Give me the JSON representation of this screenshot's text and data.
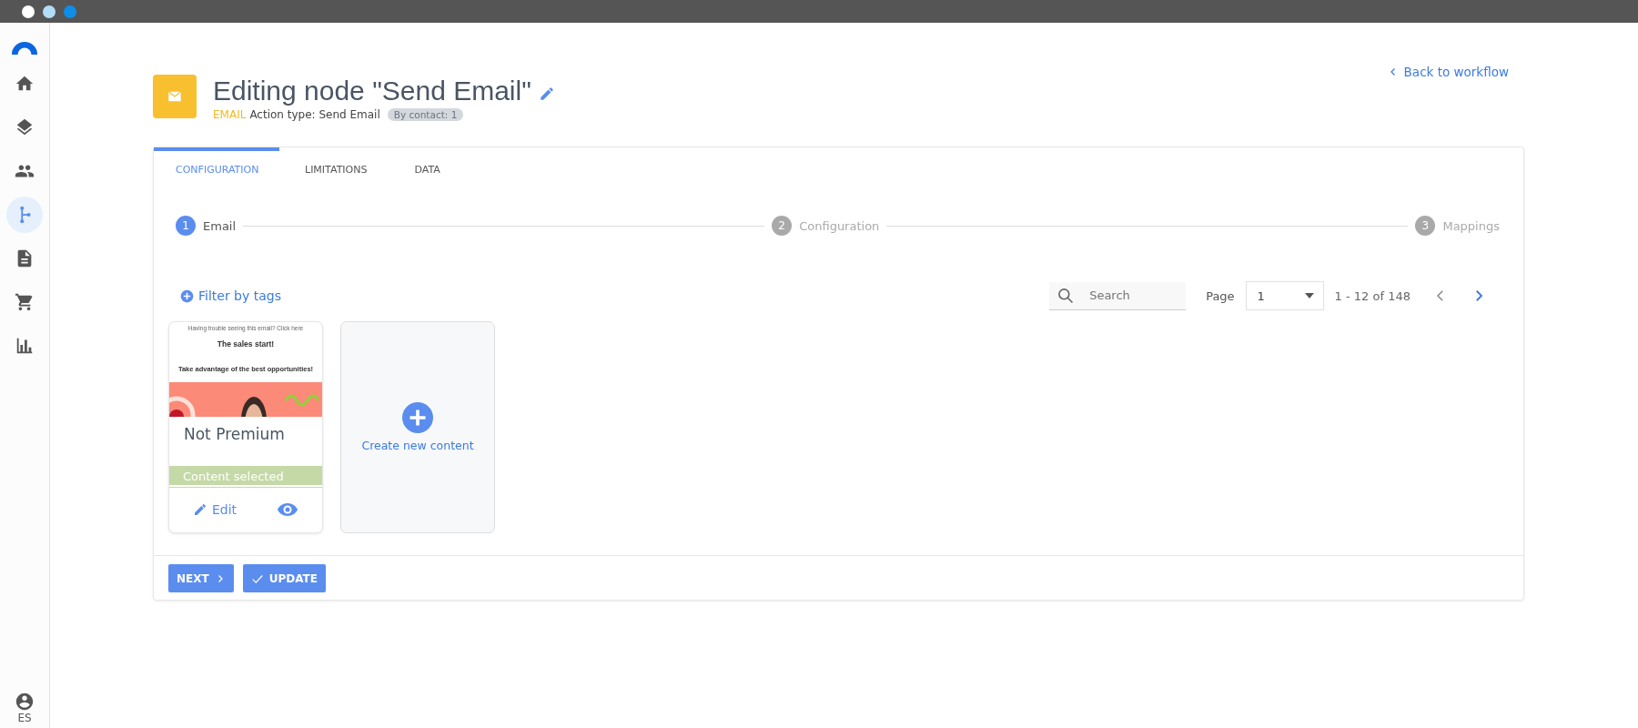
{
  "sidebar": {
    "items": [
      {
        "kind": "home",
        "selected": false
      },
      {
        "kind": "layers",
        "selected": false
      },
      {
        "kind": "people",
        "selected": false
      },
      {
        "kind": "branch",
        "selected": true
      },
      {
        "kind": "document",
        "selected": false
      },
      {
        "kind": "cart",
        "selected": false
      },
      {
        "kind": "chart",
        "selected": false
      }
    ],
    "user": {
      "label": "ES"
    }
  },
  "header": {
    "title": "Editing node \"Send Email\"",
    "channel": "EMAIL",
    "action_type": "Action type: Send Email",
    "badge": "By contact: 1",
    "back_link": "Back to workflow"
  },
  "tabs": [
    {
      "label": "CONFIGURATION",
      "selected": true
    },
    {
      "label": "LIMITATIONS",
      "selected": false
    },
    {
      "label": "DATA",
      "selected": false
    }
  ],
  "steps": [
    {
      "number": "1",
      "label": "Email",
      "selected": true
    },
    {
      "number": "2",
      "label": "Configuration",
      "selected": false
    },
    {
      "number": "3",
      "label": "Mappings",
      "selected": false
    }
  ],
  "filter_link": "Filter by tags",
  "search": {
    "placeholder": "Search"
  },
  "pager": {
    "label": "Page",
    "page": "1",
    "range": "1 - 12 of 148"
  },
  "contents": [
    {
      "kind": "template",
      "preview_note": "Having trouble seeing this email? Click here",
      "preview_heading": "The sales start!",
      "preview_text": "Take advantage of the best opportunities!",
      "name": "Not Premium",
      "status": "Content selected",
      "edit": "Edit"
    },
    {
      "kind": "create",
      "label": "Create new content"
    }
  ],
  "buttons": [
    {
      "kind": "next",
      "label": "NEXT"
    },
    {
      "kind": "update",
      "label": "UPDATE"
    }
  ]
}
